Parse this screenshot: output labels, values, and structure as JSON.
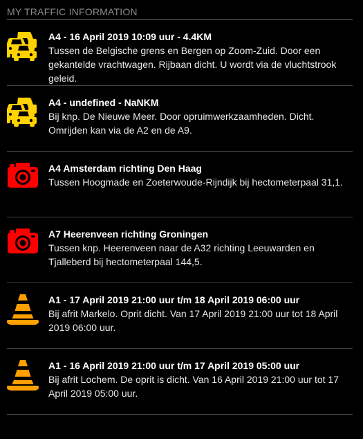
{
  "header": {
    "title": "MY TRAFFIC INFORMATION"
  },
  "colors": {
    "background": "#000000",
    "traffic_jam_icon": "#ffd200",
    "speed_camera_icon": "#ff0000",
    "roadworks_icon": "#ff9f00",
    "header_text": "#8a8a8a",
    "divider": "#444444"
  },
  "items": [
    {
      "icon": "traffic-jam-icon",
      "title": "A4 - 16 April 2019 10:09 uur - 4.4KM",
      "description": "Tussen de Belgische grens en Bergen op Zoom-Zuid. Door een gekantelde vrachtwagen. Rijbaan dicht. U wordt via de vluchtstrook geleid."
    },
    {
      "icon": "traffic-jam-icon",
      "title": "A4 - undefined - NaNKM",
      "description": "Bij knp. De Nieuwe Meer. Door opruimwerkzaamheden. Dicht. Omrijden kan via de A2 en de A9."
    },
    {
      "icon": "speed-camera-icon",
      "title": "A4 Amsterdam richting Den Haag",
      "description": "Tussen Hoogmade en Zoeterwoude-Rijndijk bij hectometerpaal 31,1."
    },
    {
      "icon": "speed-camera-icon",
      "title": "A7 Heerenveen richting Groningen",
      "description": "Tussen knp. Heerenveen naar de A32 richting Leeuwarden en Tjalleberd bij hectometerpaal 144,5."
    },
    {
      "icon": "traffic-cone-icon",
      "title": "A1 - 17 April 2019 21:00 uur t/m 18 April 2019 06:00 uur",
      "description": "Bij afrit Markelo. Oprit dicht. Van 17 April 2019 21:00 uur tot 18 April 2019 06:00 uur."
    },
    {
      "icon": "traffic-cone-icon",
      "title": "A1 - 16 April 2019 21:00 uur t/m 17 April 2019 05:00 uur",
      "description": "Bij afrit Lochem. De oprit is dicht. Van 16 April 2019 21:00 uur tot 17 April 2019 05:00 uur."
    }
  ]
}
